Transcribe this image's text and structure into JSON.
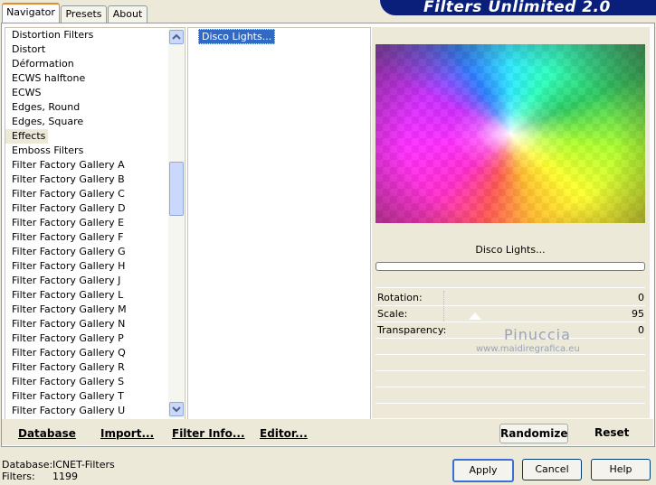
{
  "tabs": [
    "Navigator",
    "Presets",
    "About"
  ],
  "app_title": "Filters Unlimited 2.0",
  "categories": [
    "Distortion Filters",
    "Distort",
    "Déformation",
    "ECWS halftone",
    "ECWS",
    "Edges, Round",
    "Edges, Square",
    "Effects",
    "Emboss Filters",
    "Filter Factory Gallery A",
    "Filter Factory Gallery B",
    "Filter Factory Gallery C",
    "Filter Factory Gallery D",
    "Filter Factory Gallery E",
    "Filter Factory Gallery F",
    "Filter Factory Gallery G",
    "Filter Factory Gallery H",
    "Filter Factory Gallery J",
    "Filter Factory Gallery L",
    "Filter Factory Gallery M",
    "Filter Factory Gallery N",
    "Filter Factory Gallery P",
    "Filter Factory Gallery Q",
    "Filter Factory Gallery R",
    "Filter Factory Gallery S",
    "Filter Factory Gallery T",
    "Filter Factory Gallery U"
  ],
  "selected_category": "Effects",
  "filters": [
    "Disco Lights..."
  ],
  "selected_filter": "Disco Lights...",
  "preview_filter_name": "Disco Lights...",
  "params": [
    {
      "label": "Rotation:",
      "value": "0"
    },
    {
      "label": "Scale:",
      "value": "95"
    },
    {
      "label": "Transparency:",
      "value": "0"
    }
  ],
  "watermark": {
    "line1": "Pinuccia",
    "line2": "www.maidiregrafica.eu"
  },
  "bottom_left_buttons": {
    "database": "Database",
    "import": "Import...",
    "filter_info": "Filter Info...",
    "editor": "Editor..."
  },
  "right_buttons": {
    "randomize": "Randomize",
    "reset": "Reset"
  },
  "status": {
    "database_label": "Database:",
    "database_value": "ICNET-Filters",
    "filters_label": "Filters:",
    "filters_value": "1199"
  },
  "dialog_buttons": {
    "apply": "Apply",
    "cancel": "Cancel",
    "help": "Help"
  },
  "colors": {
    "window_bg": "#ece9d8",
    "selection": "#316ac5",
    "banner": "#0a1f7a",
    "tab_accent": "#e68b2c"
  }
}
